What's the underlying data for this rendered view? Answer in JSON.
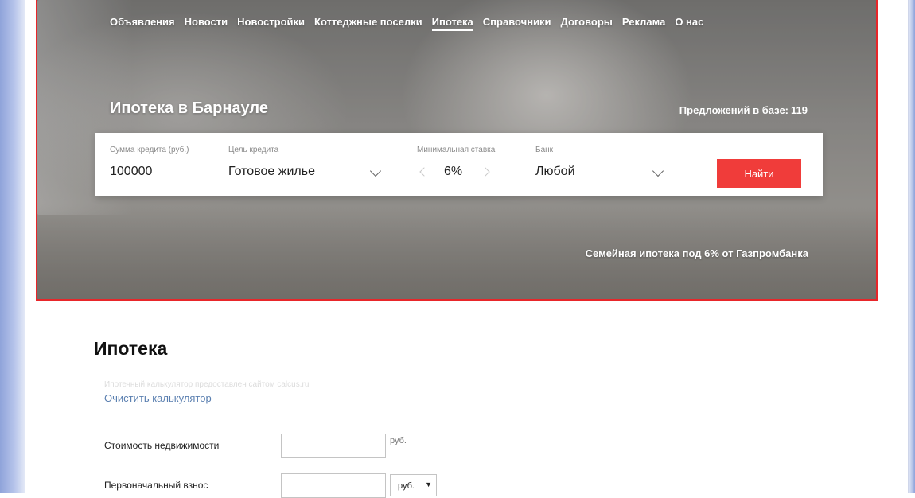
{
  "nav": {
    "items": [
      {
        "label": "Объявления"
      },
      {
        "label": "Новости"
      },
      {
        "label": "Новостройки"
      },
      {
        "label": "Коттеджные поселки"
      },
      {
        "label": "Ипотека"
      },
      {
        "label": "Справочники"
      },
      {
        "label": "Договоры"
      },
      {
        "label": "Реклама"
      },
      {
        "label": "О нас"
      }
    ],
    "active": "Ипотека"
  },
  "hero": {
    "title": "Ипотека в Барнауле",
    "offers_label": "Предложений в базе:",
    "offers_count": "119",
    "promo": "Семейная ипотека под 6% от Газпромбанка"
  },
  "search": {
    "amount_label": "Сумма кредита (руб.)",
    "amount_value": "100000",
    "purpose_label": "Цель кредита",
    "purpose_value": "Готовое жилье",
    "rate_label": "Минимальная ставка",
    "rate_value": "6%",
    "bank_label": "Банк",
    "bank_value": "Любой",
    "button": "Найти"
  },
  "calculator": {
    "title": "Ипотека",
    "provided_by": "Ипотечный калькулятор предоставлен сайтом calcus.ru",
    "clear": "Очистить калькулятор",
    "property_cost_label": "Стоимость недвижимости",
    "property_cost_value": "",
    "property_cost_unit": "руб.",
    "down_payment_label": "Первоначальный взнос",
    "down_payment_value": "",
    "down_payment_unit": "руб."
  },
  "colors": {
    "accent": "#f03c3a",
    "hero_border": "#e8262a",
    "link": "#5a7fb0"
  }
}
